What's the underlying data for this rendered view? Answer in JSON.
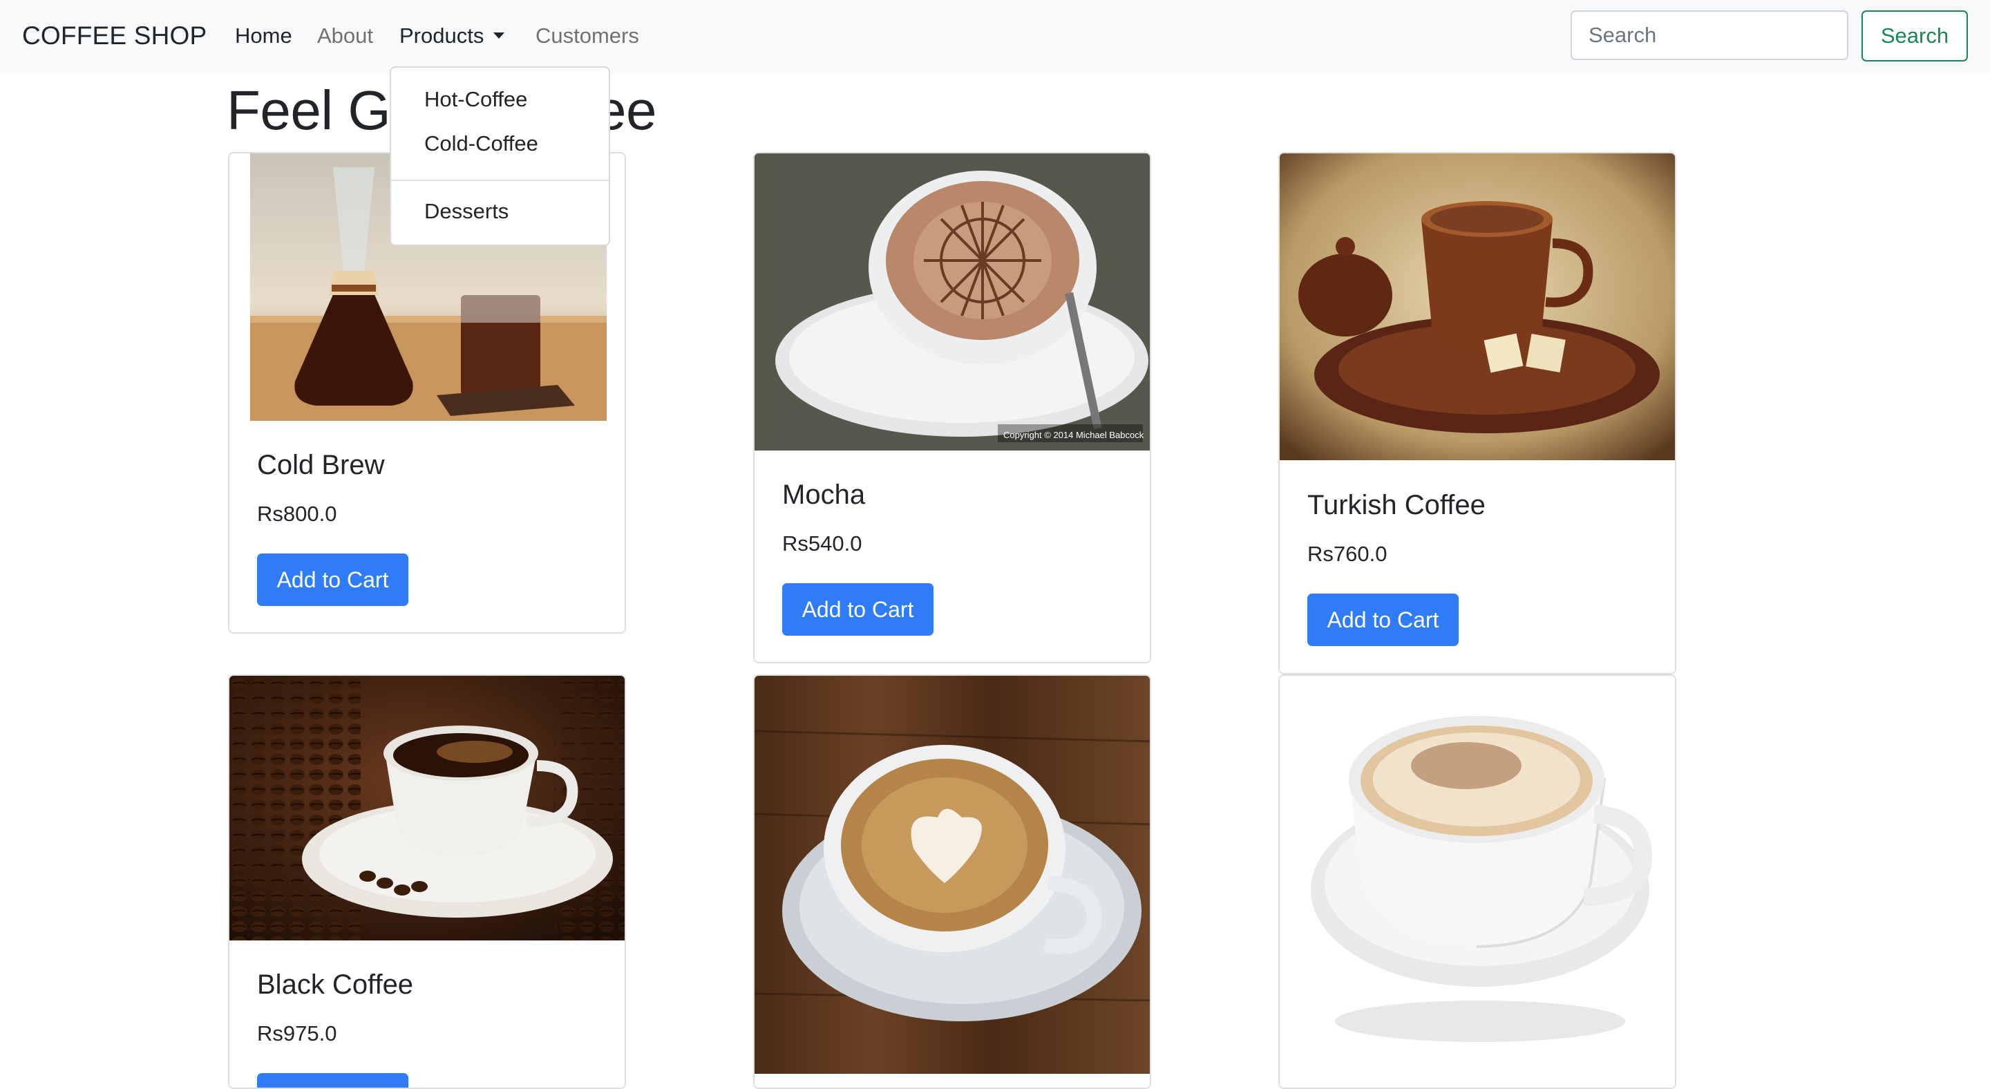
{
  "navbar": {
    "brand": "COFFEE SHOP",
    "links": {
      "home": "Home",
      "about": "About",
      "products": "Products",
      "customers": "Customers"
    },
    "search_placeholder": "Search",
    "search_button": "Search"
  },
  "dropdown": {
    "items": [
      "Hot-Coffee",
      "Cold-Coffee",
      "Desserts"
    ]
  },
  "heading": "Feel Good Coffee",
  "cards": [
    {
      "name": "Cold Brew",
      "price": "Rs800.0",
      "button": "Add to Cart",
      "image": "cold-brew-chemex-photo"
    },
    {
      "name": "Mocha",
      "price": "Rs540.0",
      "button": "Add to Cart",
      "image": "mocha-cup-photo",
      "image_caption": "Copyright © 2014 Michael Babcock"
    },
    {
      "name": "Turkish Coffee",
      "price": "Rs760.0",
      "button": "Add to Cart",
      "image": "turkish-coffee-photo"
    },
    {
      "name": "Black Coffee",
      "price": "Rs975.0",
      "button": "Add to Cart",
      "image": "black-coffee-beans-photo"
    },
    {
      "name": "",
      "price": "",
      "button": "",
      "image": "latte-art-photo"
    },
    {
      "name": "",
      "price": "",
      "button": "",
      "image": "cappuccino-photo"
    }
  ],
  "colors": {
    "navbar_bg": "#f8f9fa",
    "primary": "#2f7cf6",
    "success": "#198754"
  }
}
